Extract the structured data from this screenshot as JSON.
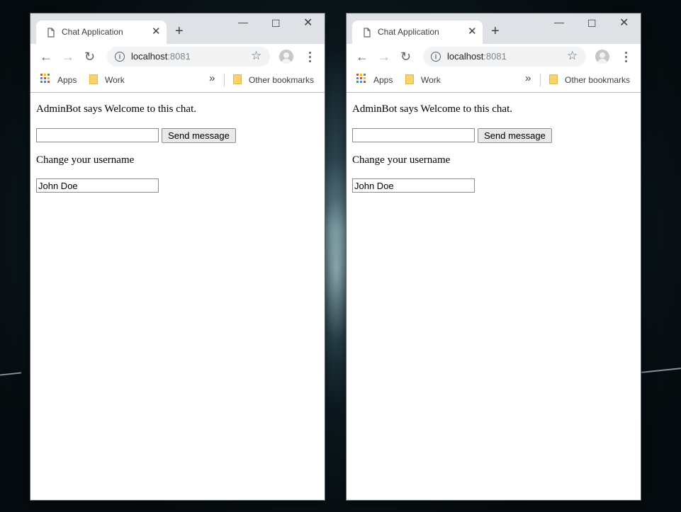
{
  "windows": [
    {
      "tab": {
        "title": "Chat Application",
        "close": "✕",
        "new_tab": "+"
      },
      "controls": {
        "minimize": "—",
        "maximize": "☐",
        "close": "✕"
      },
      "toolbar": {
        "back": "←",
        "forward": "→",
        "reload": "↻",
        "info": "i",
        "url_host": "localhost",
        "url_port": ":8081",
        "star": "☆"
      },
      "bookmarks": {
        "apps": "Apps",
        "work": "Work",
        "overflow": "»",
        "other": "Other bookmarks"
      },
      "chat": {
        "message": "AdminBot says Welcome to this chat.",
        "message_input": "",
        "send_label": "Send message",
        "change_label": "Change your username",
        "username": "John Doe"
      }
    },
    {
      "tab": {
        "title": "Chat Application",
        "close": "✕",
        "new_tab": "+"
      },
      "controls": {
        "minimize": "—",
        "maximize": "☐",
        "close": "✕"
      },
      "toolbar": {
        "back": "←",
        "forward": "→",
        "reload": "↻",
        "info": "i",
        "url_host": "localhost",
        "url_port": ":8081",
        "star": "☆"
      },
      "bookmarks": {
        "apps": "Apps",
        "work": "Work",
        "overflow": "»",
        "other": "Other bookmarks"
      },
      "chat": {
        "message": "AdminBot says Welcome to this chat.",
        "message_input": "",
        "send_label": "Send message",
        "change_label": "Change your username",
        "username": "John Doe"
      }
    }
  ],
  "icons": [
    "page-icon",
    "close-icon",
    "new-tab-icon",
    "minimize-icon",
    "maximize-icon",
    "back-icon",
    "forward-icon",
    "reload-icon",
    "info-icon",
    "star-icon",
    "profile-icon",
    "menu-icon",
    "apps-icon",
    "folder-icon",
    "chevron-double-icon"
  ],
  "colors": {
    "titlebar": "#dee1e6",
    "omnibox": "#f1f3f4",
    "folder": "#f6d36b",
    "url_port": "#80868b"
  }
}
